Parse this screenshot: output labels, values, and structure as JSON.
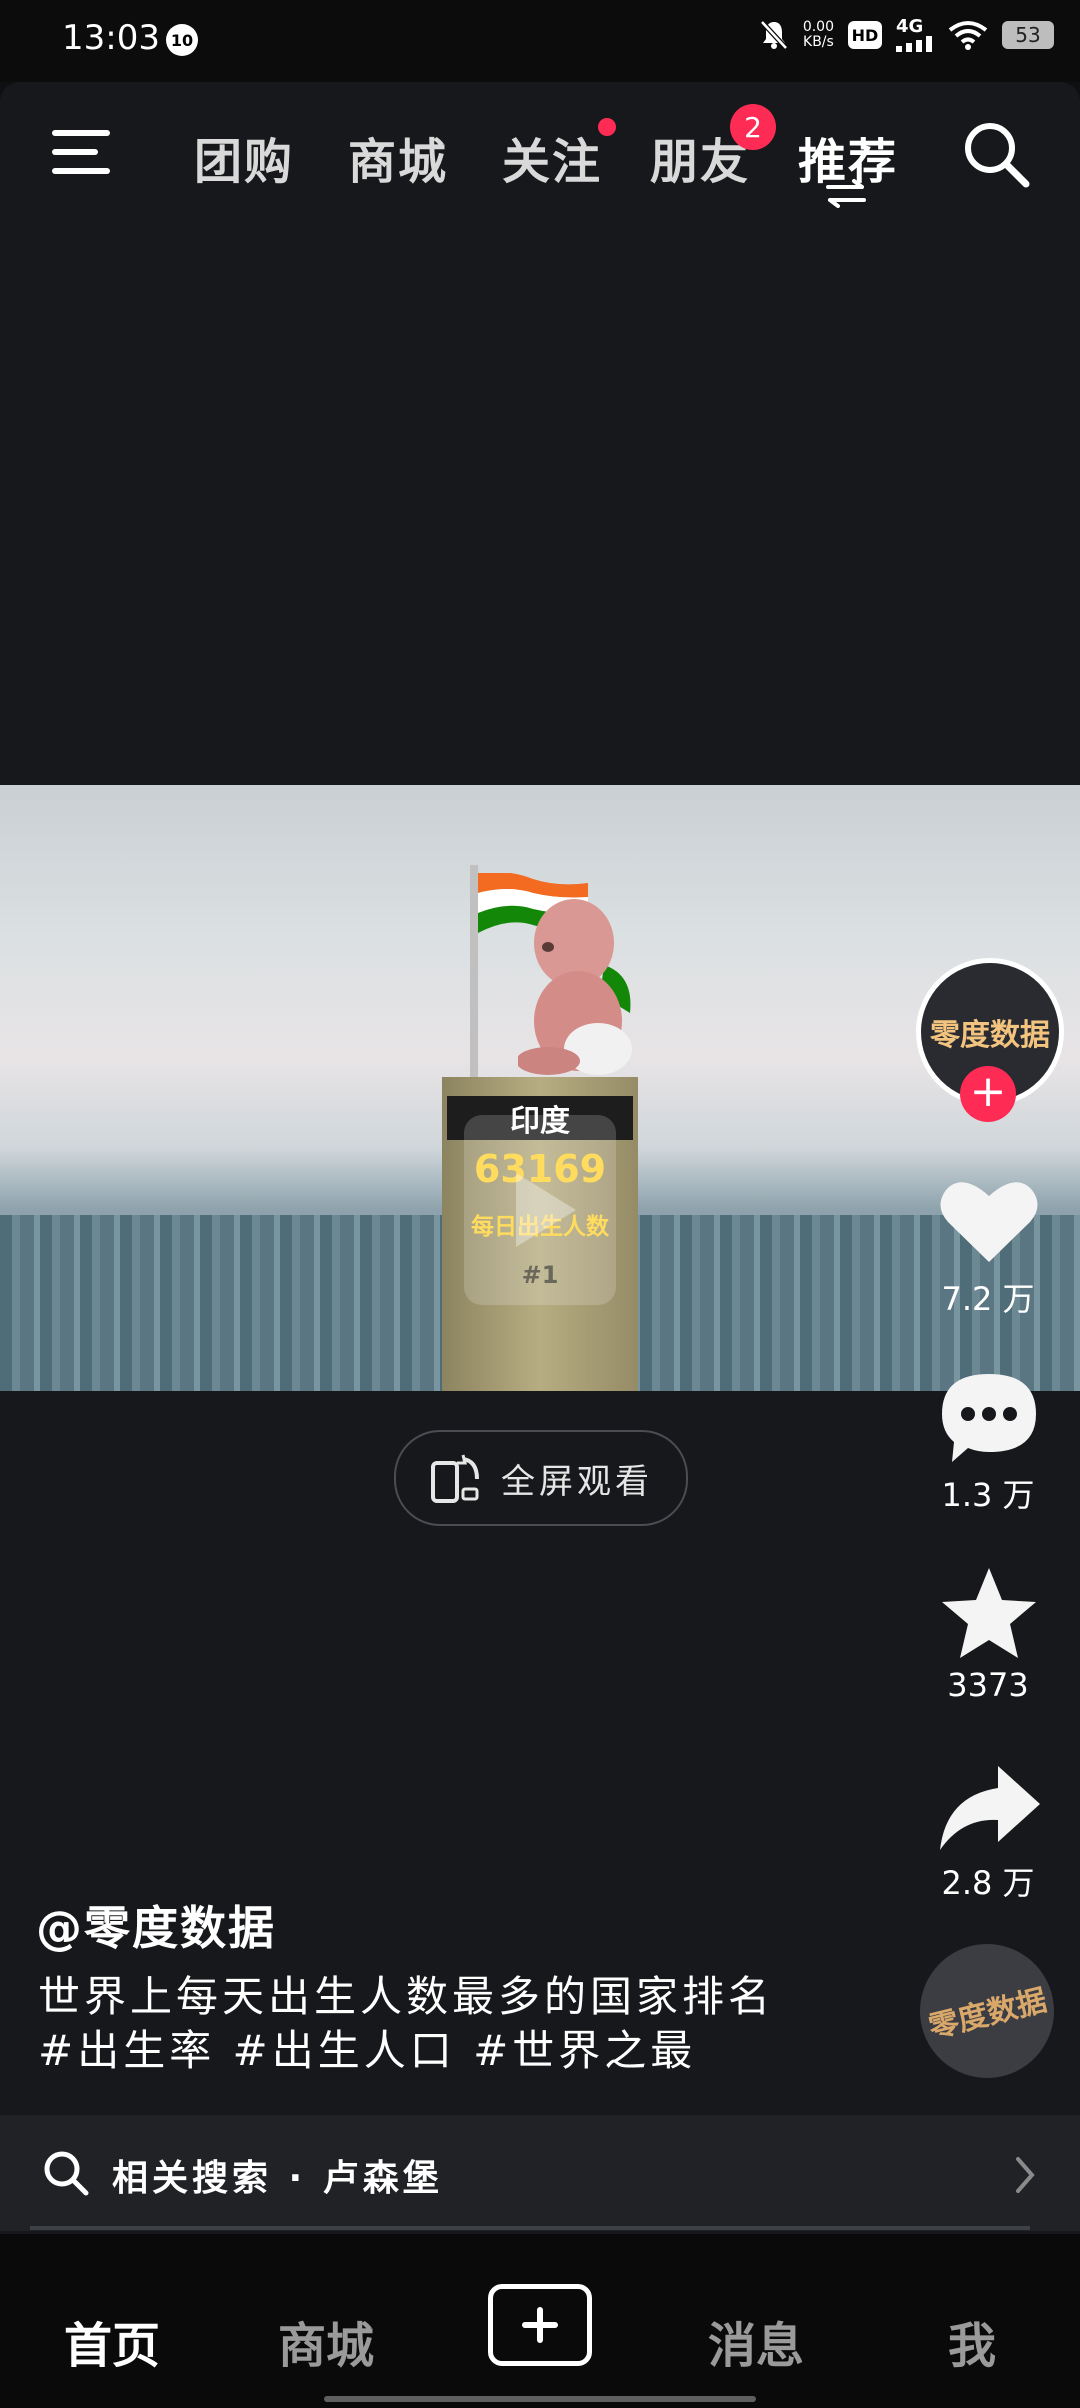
{
  "status_bar": {
    "time": "13:03",
    "notification_badge": "10",
    "net_speed_value": "0.00",
    "net_speed_unit": "KB/s",
    "hd": "HD",
    "network": "4G",
    "battery": "53"
  },
  "top_nav": {
    "tabs": [
      {
        "label": "团购"
      },
      {
        "label": "商城"
      },
      {
        "label": "关注"
      },
      {
        "label": "朋友",
        "badge": "2"
      },
      {
        "label": "推荐"
      }
    ],
    "active_tab": "推荐"
  },
  "video": {
    "overlay_country": "印度",
    "overlay_number": "63169",
    "overlay_label": "每日出生人数",
    "overlay_rank": "#1"
  },
  "fullscreen": {
    "label": "全屏观看"
  },
  "actions": {
    "avatar_text": "零度数据",
    "likes": "7.2 万",
    "comments": "1.3 万",
    "favorites": "3373",
    "shares": "2.8 万",
    "music_disc_text": "零度数据"
  },
  "caption": {
    "author": "@零度数据",
    "description": "世界上每天出生人数最多的国家排名 #出生率 #出生人口 #世界之最"
  },
  "related_search": {
    "text": "相关搜索 · 卢森堡"
  },
  "bottom_nav": {
    "tabs": [
      "首页",
      "商城",
      "消息",
      "我"
    ],
    "active": "首页"
  },
  "colors": {
    "accent": "#fe2c55",
    "background": "#16181b",
    "overlay_yellow": "#ffd43b"
  }
}
